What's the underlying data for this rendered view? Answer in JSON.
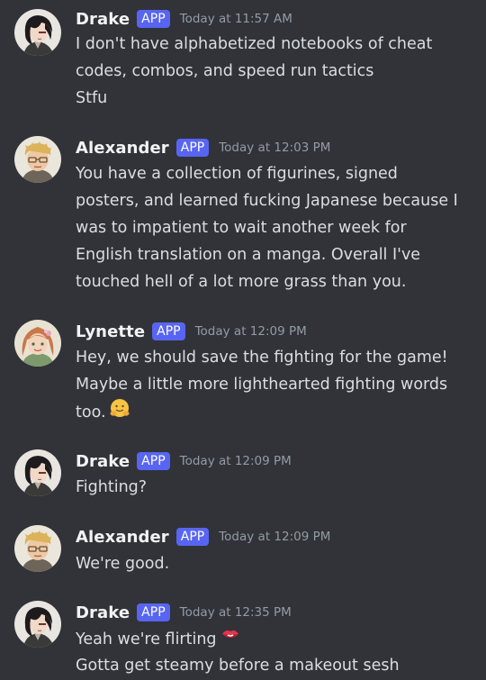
{
  "messages": [
    {
      "username": "Drake",
      "badge": "APP",
      "timestamp": "Today at 11:57 AM",
      "lines": [
        "I don't have alphabetized notebooks of cheat",
        "codes, combos, and speed run tactics",
        "Stfu"
      ]
    },
    {
      "username": "Alexander",
      "badge": "APP",
      "timestamp": "Today at 12:03 PM",
      "lines": [
        "You have a collection of figurines, signed",
        "posters, and learned fucking Japanese because I",
        "was to impatient to wait another week for",
        "English translation on a manga. Overall I've",
        "touched hell of a lot more grass than you."
      ]
    },
    {
      "username": "Lynette",
      "badge": "APP",
      "timestamp": "Today at 12:09 PM",
      "lines": [
        "Hey, we should save the fighting for the game!",
        "Maybe a little more lighthearted fighting words",
        "too."
      ]
    },
    {
      "username": "Drake",
      "badge": "APP",
      "timestamp": "Today at 12:09 PM",
      "lines": [
        "Fighting?"
      ]
    },
    {
      "username": "Alexander",
      "badge": "APP",
      "timestamp": "Today at 12:09 PM",
      "lines": [
        "We're good."
      ]
    },
    {
      "username": "Drake",
      "badge": "APP",
      "timestamp": "Today at 12:35 PM",
      "lines": [
        "Yeah we're flirting",
        "Gotta get steamy before a makeout sesh"
      ]
    }
  ],
  "emojis": {
    "hug": "hugging-face-icon",
    "lips": "biting-lip-icon"
  },
  "colors": {
    "background": "#313338",
    "badge": "#5865f2",
    "username": "#f2f3f5",
    "timestamp": "#949ba4",
    "text": "#dbdee1"
  }
}
